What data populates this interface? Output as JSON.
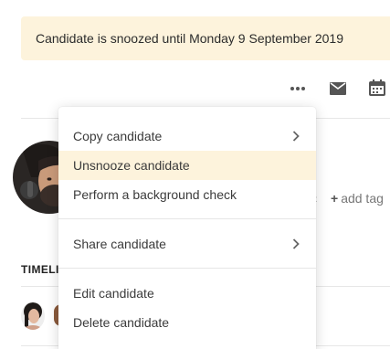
{
  "banner": {
    "text": "Candidate is snoozed until Monday 9 September 2019"
  },
  "toolbar": {
    "icons": [
      "more-horizontal-icon",
      "mail-icon",
      "calendar-icon"
    ]
  },
  "tags": {
    "add_label": "add tag",
    "add_symbol": "+"
  },
  "tabs": {
    "first_label_visible": "TIMELI"
  },
  "menu": {
    "groups": [
      [
        {
          "label": "Copy candidate",
          "has_submenu": true
        },
        {
          "label": "Unsnooze candidate",
          "has_submenu": false,
          "highlighted": true
        },
        {
          "label": "Perform a background check",
          "has_submenu": false
        }
      ],
      [
        {
          "label": "Share candidate",
          "has_submenu": true
        }
      ],
      [
        {
          "label": "Edit candidate",
          "has_submenu": false
        },
        {
          "label": "Delete candidate",
          "has_submenu": false
        }
      ]
    ]
  },
  "colors": {
    "banner_bg": "#fdf3dc",
    "highlight_bg": "#fdf3dc",
    "icon": "#555555"
  }
}
